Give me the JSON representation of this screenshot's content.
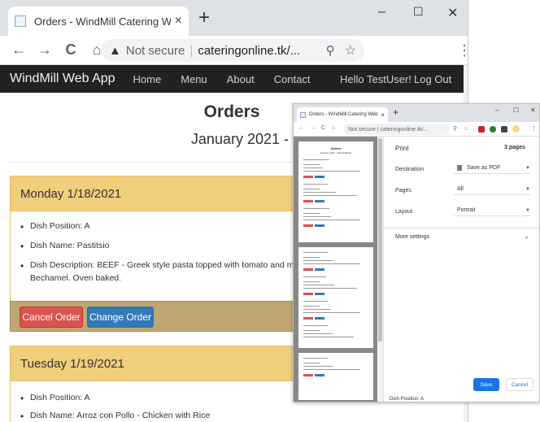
{
  "browser": {
    "tab_title": "Orders - WindMill Catering Web/",
    "tab_close": "×",
    "new_tab": "+",
    "controls": {
      "minimize": "–",
      "maximize": "☐",
      "close": "✕"
    },
    "nav": {
      "back": "←",
      "forward": "→",
      "reload": "C",
      "home": "⌂"
    },
    "address": {
      "warning": "▲",
      "security": "Not secure",
      "url": "cateringonline.tk/..."
    },
    "zoom_icon": "⚲",
    "star_icon": "☆",
    "extensions": [
      "ublock-icon",
      "shield-icon",
      "puzzle-icon",
      "profile-avatar"
    ],
    "menu": "⋮"
  },
  "site": {
    "brand": "WindMill Web App",
    "nav": [
      "Home",
      "Menu",
      "About",
      "Contact"
    ],
    "greeting": "Hello TestUser!",
    "logout": "Log Out"
  },
  "page": {
    "title": "Orders",
    "subtitle": "January 2021 - School Menu"
  },
  "orders": [
    {
      "day": "Monday 1/18/2021",
      "items": [
        "Dish Position: A",
        "Dish Name: Pastitsio",
        "Dish Description: BEEF - Greek style pasta topped with tomato and meat sauce and",
        "Bechamel. Oven baked."
      ],
      "cancel_label": "Cancel Order",
      "change_label": "Change Order"
    },
    {
      "day": "Tuesday 1/19/2021",
      "items": [
        "Dish Position: A",
        "Dish Name: Arroz con Pollo - Chicken with Rice"
      ]
    }
  ],
  "print_dialog": {
    "tab_title": "Orders - WindMill Catering Web",
    "address": "Not secure  |  cateringonline.tk/...",
    "preview_title": "Orders",
    "preview_subtitle": "January 2021 - School Menu",
    "preview_footer": "Dish Position: A",
    "heading": "Print",
    "pages_count": "3 pages",
    "destination_label": "Destination",
    "destination_value": "Save as PDF",
    "pages_label": "Pages",
    "pages_value": "All",
    "layout_label": "Layout",
    "layout_value": "Portrait",
    "more_settings": "More settings",
    "save_label": "Save",
    "cancel_label": "Cancel"
  },
  "colors": {
    "panel_header": "#f0ce7c",
    "panel_footer": "#bfa773",
    "cancel_button": "#d9534f",
    "change_button": "#337ab7",
    "navbar": "#222222",
    "print_save": "#1a73e8"
  }
}
